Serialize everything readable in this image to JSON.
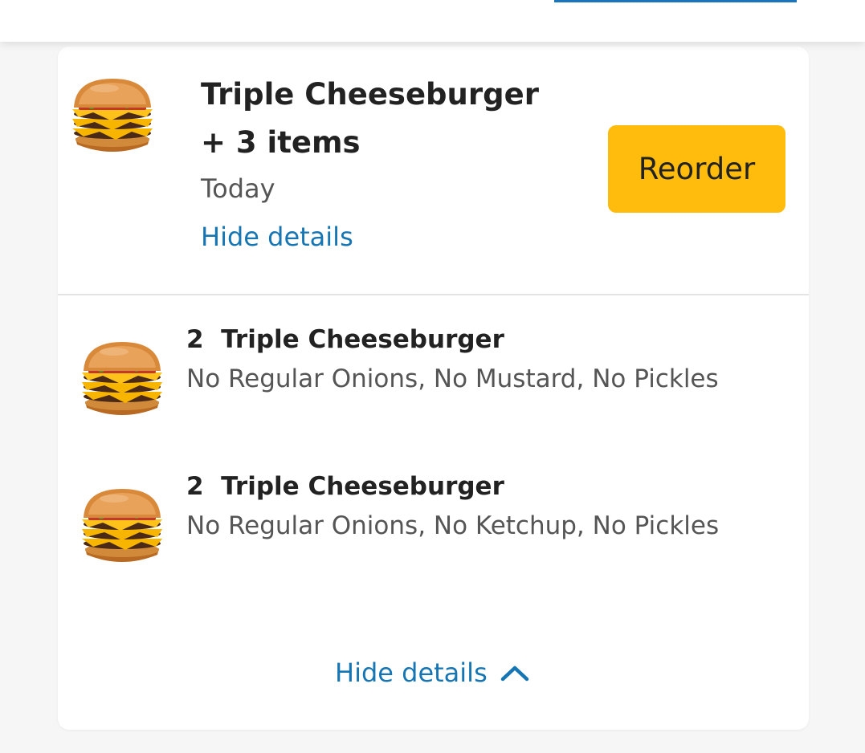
{
  "order": {
    "title": "Triple Cheeseburger",
    "count_label": "+ 3 items",
    "date": "Today",
    "hide_details_label": "Hide details",
    "reorder_label": "Reorder"
  },
  "items": [
    {
      "quantity": "2",
      "name": "Triple Cheeseburger",
      "modifications": "No Regular Onions, No Mustard, No Pickles"
    },
    {
      "quantity": "2",
      "name": "Triple Cheeseburger",
      "modifications": "No Regular Onions, No Ketchup, No Pickles"
    }
  ],
  "footer": {
    "hide_details_label": "Hide details",
    "icon": "chevron-up-icon"
  },
  "colors": {
    "accent_yellow": "#ffbc0d",
    "link_blue": "#1676b4",
    "text_dark": "#222222",
    "text_muted": "#555555"
  }
}
